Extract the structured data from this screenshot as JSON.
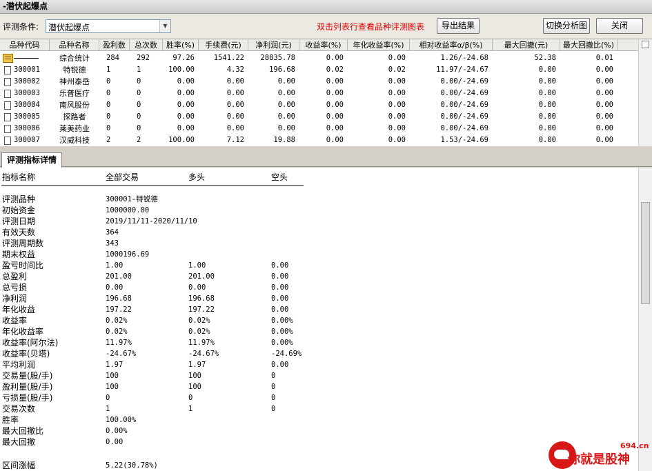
{
  "window": {
    "title": "-潜伏起爆点"
  },
  "toolbar": {
    "condition_label": "评测条件:",
    "condition_value": "潜伏起爆点",
    "hint": "双击列表行查看品种评测图表",
    "export_label": "导出结果",
    "switch_label": "切换分析图",
    "close_label": "关闭"
  },
  "grid": {
    "columns": [
      "品种代码",
      "品种名称",
      "盈利数",
      "总次数",
      "胜率(%)",
      "手续费(元)",
      "净利润(元)",
      "收益率(%)",
      "年化收益率(%)",
      "相对收益率α/β(%)",
      "最大回撤(元)",
      "最大回撤比(%)"
    ],
    "summary": {
      "code": "",
      "name": "综合统计",
      "win": "284",
      "total": "292",
      "winrate": "97.26",
      "fee": "1541.22",
      "net": "28835.78",
      "ret": "0.00",
      "annual": "0.00",
      "ab": "1.26/-24.68",
      "maxdd": "52.38",
      "ddratio": "0.01"
    },
    "rows": [
      {
        "code": "300001",
        "name": "特锐德",
        "win": "1",
        "total": "1",
        "winrate": "100.00",
        "fee": "4.32",
        "net": "196.68",
        "ret": "0.02",
        "annual": "0.02",
        "ab": "11.97/-24.67",
        "maxdd": "0.00",
        "ddratio": "0.00"
      },
      {
        "code": "300002",
        "name": "神州泰岳",
        "win": "0",
        "total": "0",
        "winrate": "0.00",
        "fee": "0.00",
        "net": "0.00",
        "ret": "0.00",
        "annual": "0.00",
        "ab": "0.00/-24.69",
        "maxdd": "0.00",
        "ddratio": "0.00"
      },
      {
        "code": "300003",
        "name": "乐普医疗",
        "win": "0",
        "total": "0",
        "winrate": "0.00",
        "fee": "0.00",
        "net": "0.00",
        "ret": "0.00",
        "annual": "0.00",
        "ab": "0.00/-24.69",
        "maxdd": "0.00",
        "ddratio": "0.00"
      },
      {
        "code": "300004",
        "name": "南风股份",
        "win": "0",
        "total": "0",
        "winrate": "0.00",
        "fee": "0.00",
        "net": "0.00",
        "ret": "0.00",
        "annual": "0.00",
        "ab": "0.00/-24.69",
        "maxdd": "0.00",
        "ddratio": "0.00"
      },
      {
        "code": "300005",
        "name": "探路者",
        "win": "0",
        "total": "0",
        "winrate": "0.00",
        "fee": "0.00",
        "net": "0.00",
        "ret": "0.00",
        "annual": "0.00",
        "ab": "0.00/-24.69",
        "maxdd": "0.00",
        "ddratio": "0.00"
      },
      {
        "code": "300006",
        "name": "莱美药业",
        "win": "0",
        "total": "0",
        "winrate": "0.00",
        "fee": "0.00",
        "net": "0.00",
        "ret": "0.00",
        "annual": "0.00",
        "ab": "0.00/-24.69",
        "maxdd": "0.00",
        "ddratio": "0.00"
      },
      {
        "code": "300007",
        "name": "汉威科技",
        "win": "2",
        "total": "2",
        "winrate": "100.00",
        "fee": "7.12",
        "net": "19.88",
        "ret": "0.00",
        "annual": "0.00",
        "ab": "1.53/-24.69",
        "maxdd": "0.00",
        "ddratio": "0.00"
      }
    ]
  },
  "detail": {
    "tab_label": "评测指标详情",
    "headers": [
      "指标名称",
      "全部交易",
      "多头",
      "空头"
    ],
    "rows": [
      {
        "label": "评测品种",
        "all": "300001-特锐德",
        "long": "",
        "short": ""
      },
      {
        "label": "初始资金",
        "all": "1000000.00",
        "long": "",
        "short": ""
      },
      {
        "label": "评测日期",
        "all": "2019/11/11-2020/11/10",
        "long": "",
        "short": ""
      },
      {
        "label": "有效天数",
        "all": "364",
        "long": "",
        "short": ""
      },
      {
        "label": "评测周期数",
        "all": "343",
        "long": "",
        "short": ""
      },
      {
        "label": "期末权益",
        "all": "1000196.69",
        "long": "",
        "short": ""
      },
      {
        "label": "盈亏时间比",
        "all": "1.00",
        "long": "1.00",
        "short": "0.00"
      },
      {
        "label": "总盈利",
        "all": "201.00",
        "long": "201.00",
        "short": "0.00"
      },
      {
        "label": "总亏损",
        "all": "0.00",
        "long": "0.00",
        "short": "0.00"
      },
      {
        "label": "净利润",
        "all": "196.68",
        "long": "196.68",
        "short": "0.00"
      },
      {
        "label": "年化收益",
        "all": "197.22",
        "long": "197.22",
        "short": "0.00"
      },
      {
        "label": "收益率",
        "all": "0.02%",
        "long": "0.02%",
        "short": "0.00%"
      },
      {
        "label": "年化收益率",
        "all": "0.02%",
        "long": "0.02%",
        "short": "0.00%"
      },
      {
        "label": "收益率(阿尔法)",
        "all": "11.97%",
        "long": "11.97%",
        "short": "0.00%"
      },
      {
        "label": "收益率(贝塔)",
        "all": "-24.67%",
        "long": "-24.67%",
        "short": "-24.69%"
      },
      {
        "label": "平均利润",
        "all": "1.97",
        "long": "1.97",
        "short": "0.00"
      },
      {
        "label": "交易量(股/手)",
        "all": "100",
        "long": "100",
        "short": "0"
      },
      {
        "label": "盈利量(股/手)",
        "all": "100",
        "long": "100",
        "short": "0"
      },
      {
        "label": "亏损量(股/手)",
        "all": "0",
        "long": "0",
        "short": "0"
      },
      {
        "label": "交易次数",
        "all": "1",
        "long": "1",
        "short": "0"
      },
      {
        "label": "胜率",
        "all": "100.00%",
        "long": "",
        "short": ""
      },
      {
        "label": "最大回撤比",
        "all": "0.00%",
        "long": "",
        "short": ""
      },
      {
        "label": "最大回撤",
        "all": "0.00",
        "long": "",
        "short": ""
      },
      {
        "label": "",
        "all": "",
        "long": "",
        "short": ""
      },
      {
        "label": "区间涨幅",
        "all": "5.22(30.78%)",
        "long": "",
        "short": ""
      }
    ]
  },
  "watermark": {
    "url": "694.cn",
    "name": "你就是股神"
  }
}
